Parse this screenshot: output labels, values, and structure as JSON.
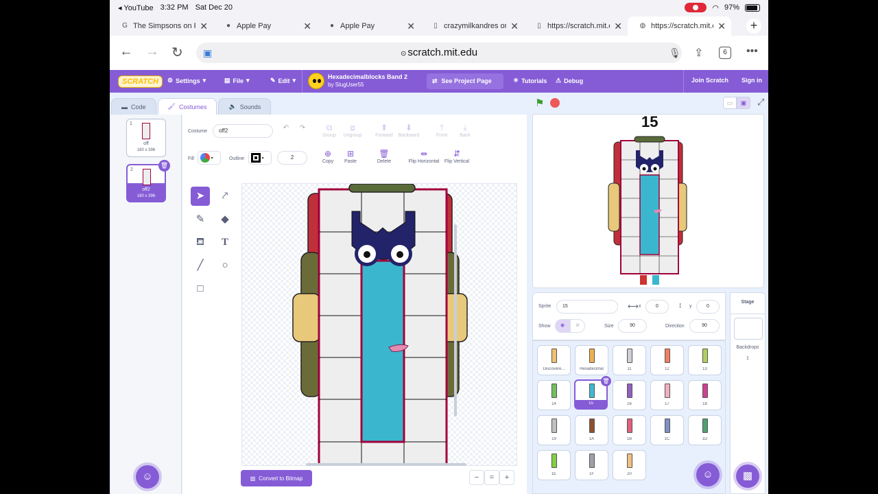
{
  "status": {
    "app": "YouTube",
    "time": "3:32 PM",
    "date": "Sat Dec 20",
    "battery": "97%"
  },
  "tabs": [
    {
      "title": "The Simpsons on Fo",
      "icon": "G"
    },
    {
      "title": "Apple Pay",
      "icon": ""
    },
    {
      "title": "Apple Pay",
      "icon": ""
    },
    {
      "title": "crazymilkandres on",
      "icon": "▯"
    },
    {
      "title": "https://scratch.mit.e",
      "icon": "▯"
    },
    {
      "title": "https://scratch.mit.e",
      "icon": "◍"
    }
  ],
  "address": {
    "url": "scratch.mit.edu",
    "tab_count": "6"
  },
  "menu": {
    "logo": "SCRATCH",
    "settings": "Settings",
    "file": "File",
    "edit": "Edit",
    "project_title": "Hexadecimalblocks Band 2",
    "author": "by SlugUser55",
    "see_project": "See Project Page",
    "tutorials": "Tutorials",
    "debug": "Debug",
    "join": "Join Scratch",
    "signin": "Sign in"
  },
  "editor_tabs": {
    "code": "Code",
    "costumes": "Costumes",
    "sounds": "Sounds"
  },
  "costumes": [
    {
      "num": "1",
      "name": "off",
      "size": "180 x 396"
    },
    {
      "num": "2",
      "name": "off2",
      "size": "180 x 396"
    }
  ],
  "paint": {
    "costume_label": "Costume",
    "costume_name": "off2",
    "fill_label": "Fill",
    "outline_label": "Outline",
    "outline_width": "2",
    "group": "Group",
    "ungroup": "Ungroup",
    "forward": "Forward",
    "backward": "Backward",
    "front": "Front",
    "back": "Back",
    "copy": "Copy",
    "paste": "Paste",
    "delete": "Delete",
    "flip_h": "Flip Horizontal",
    "flip_v": "Flip Vertical",
    "convert": "Convert to Bitmap",
    "zoom_out": "−",
    "zoom_reset": "=",
    "zoom_in": "+"
  },
  "stage": {
    "number_label": "15"
  },
  "sprite_info": {
    "sprite_label": "Sprite",
    "sprite_name": "15",
    "x_label": "x",
    "x": "0",
    "y_label": "y",
    "y": "0",
    "show_label": "Show",
    "size_label": "Size",
    "size": "90",
    "direction_label": "Direction",
    "direction": "90"
  },
  "sprites": [
    {
      "name": "Discovere...",
      "color": "#f0c070"
    },
    {
      "name": "Hexadecimal",
      "color": "#f0b050"
    },
    {
      "name": "11",
      "color": "#d0d0d8"
    },
    {
      "name": "12",
      "color": "#f08060"
    },
    {
      "name": "13",
      "color": "#b0d060"
    },
    {
      "name": "14",
      "color": "#70c060"
    },
    {
      "name": "15",
      "color": "#40b8d0"
    },
    {
      "name": "16",
      "color": "#9060c0"
    },
    {
      "name": "17",
      "color": "#f0b0c0"
    },
    {
      "name": "18",
      "color": "#d04090"
    },
    {
      "name": "19",
      "color": "#c0c0c0"
    },
    {
      "name": "1A",
      "color": "#905030"
    },
    {
      "name": "1B",
      "color": "#e06080"
    },
    {
      "name": "1C",
      "color": "#8090c0"
    },
    {
      "name": "1D",
      "color": "#50a070"
    },
    {
      "name": "1E",
      "color": "#80d040"
    },
    {
      "name": "1F",
      "color": "#a0a0a8"
    },
    {
      "name": "20",
      "color": "#f0c080"
    }
  ],
  "stage_panel": {
    "label": "Stage",
    "backdrops_label": "Backdrops",
    "backdrops_count": "1"
  },
  "colors": {
    "accent": "#855cd6",
    "column_red": "#a2003a",
    "teal": "#3ab7cf"
  }
}
